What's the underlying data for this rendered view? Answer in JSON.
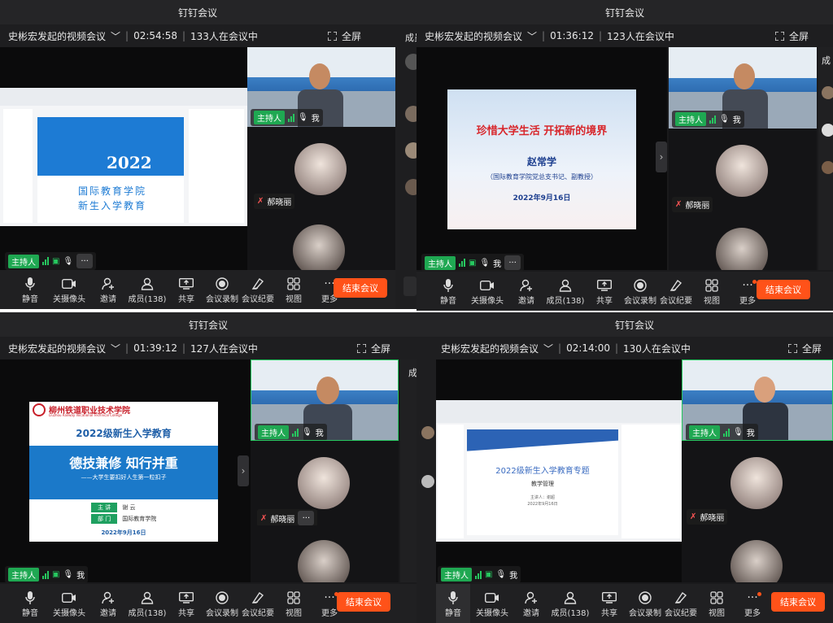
{
  "app_title": "钉钉会议",
  "meeting_owner": "史彬宏发起的视频会议",
  "fullscreen_label": "全屏",
  "host_label": "主持人",
  "me_label": "我",
  "participant_name": "郝晓丽",
  "end_label": "结束会议",
  "side_clip": "成",
  "side_clip2": "成员",
  "windows": [
    {
      "timer": "02:54:58",
      "count_text": "133人在会议中"
    },
    {
      "timer": "01:36:12",
      "count_text": "123人在会议中"
    },
    {
      "timer": "01:39:12",
      "count_text": "127人在会议中"
    },
    {
      "timer": "02:14:00",
      "count_text": "130人在会议中"
    }
  ],
  "controls": [
    {
      "label": "静音",
      "icon": "mic-icon"
    },
    {
      "label": "关摄像头",
      "icon": "camera-icon"
    },
    {
      "label": "邀请",
      "icon": "invite-icon"
    },
    {
      "label": "成员(138)",
      "icon": "members-icon"
    },
    {
      "label": "共享",
      "icon": "share-icon"
    },
    {
      "label": "会议录制",
      "icon": "record-icon"
    },
    {
      "label": "会议纪要",
      "icon": "minutes-icon"
    },
    {
      "label": "视图",
      "icon": "view-icon"
    },
    {
      "label": "更多",
      "icon": "more-icon"
    }
  ],
  "slide1": {
    "year": "2022",
    "line1": "国际教育学院",
    "line2": "新生入学教育"
  },
  "slide2": {
    "title": "珍惜大学生活  开拓新的境界",
    "speaker": "赵常学",
    "role": "（国际教育学院党总支书记、副教授）",
    "date": "2022年9月16日"
  },
  "slide3": {
    "school": "柳州铁道职业技术学院",
    "school_en": "Liuzhou Railway Vocational Technical College",
    "heading": "2022级新生入学教育",
    "motto": "德技兼修 知行并重",
    "sub": "——大学生要扣好人生第一粒扣子",
    "speaker_label": "主 讲",
    "speaker": "谢 云",
    "dept_label": "部 门",
    "dept": "国际教育学院",
    "date": "2022年9月16日"
  },
  "slide4": {
    "title": "2022级新生入学教育专题",
    "subtitle": "教学管理",
    "presenter": "主讲人：谢超",
    "date": "2022年9月16日"
  },
  "colors": {
    "end": "#ff5219",
    "host": "#1fa852",
    "bg": "#1a1a1c"
  }
}
